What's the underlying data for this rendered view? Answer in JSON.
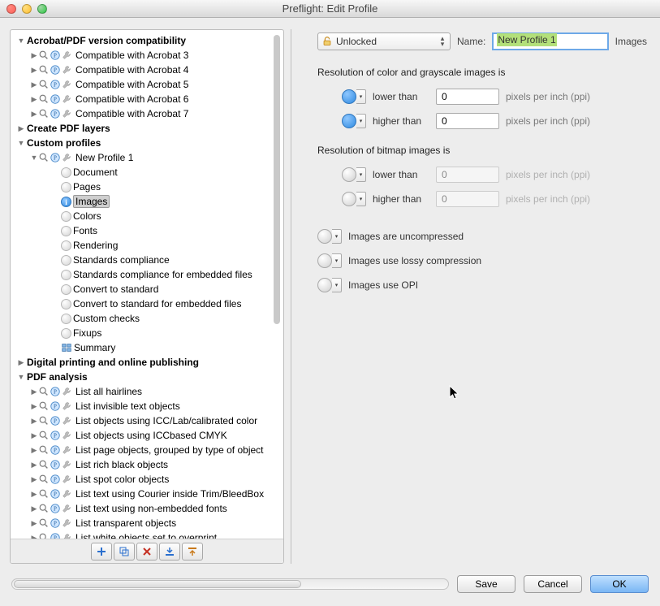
{
  "window_title": "Preflight: Edit Profile",
  "lock": {
    "label": "Unlocked"
  },
  "name_label": "Name:",
  "name_value": "New Profile 1",
  "active_panel": "Images",
  "section_color": "Resolution of color and grayscale images is",
  "section_bitmap": "Resolution of bitmap images is",
  "lower_label": "lower than",
  "higher_label": "higher than",
  "color_lower_value": "0",
  "color_higher_value": "0",
  "bitmap_lower_value": "0",
  "bitmap_higher_value": "0",
  "ppi_label": "pixels per inch (ppi)",
  "chk_uncompressed": "Images are uncompressed",
  "chk_lossy": "Images use lossy compression",
  "chk_opi": "Images use OPI",
  "buttons": {
    "save": "Save",
    "cancel": "Cancel",
    "ok": "OK"
  },
  "sections": {
    "compat": "Acrobat/PDF version compatibility",
    "create": "Create PDF layers",
    "custom": "Custom profiles",
    "digital": "Digital printing and online publishing",
    "analysis": "PDF analysis"
  },
  "compat_items": [
    "Compatible with Acrobat 3",
    "Compatible with Acrobat 4",
    "Compatible with Acrobat 5",
    "Compatible with Acrobat 6",
    "Compatible with Acrobat 7"
  ],
  "custom_profile_name": "New Profile 1",
  "custom_children": [
    "Document",
    "Pages",
    "Images",
    "Colors",
    "Fonts",
    "Rendering",
    "Standards compliance",
    "Standards compliance for embedded files",
    "Convert to standard",
    "Convert to standard for embedded files",
    "Custom checks",
    "Fixups",
    "Summary"
  ],
  "analysis_items": [
    "List all hairlines",
    "List invisible text objects",
    "List objects using ICC/Lab/calibrated color",
    "List objects using ICCbased CMYK",
    "List page objects, grouped by type of object",
    "List rich black objects",
    "List spot color objects",
    "List text using Courier inside Trim/BleedBox",
    "List text using non-embedded fonts",
    "List transparent objects",
    "List white objects set to overprint"
  ]
}
